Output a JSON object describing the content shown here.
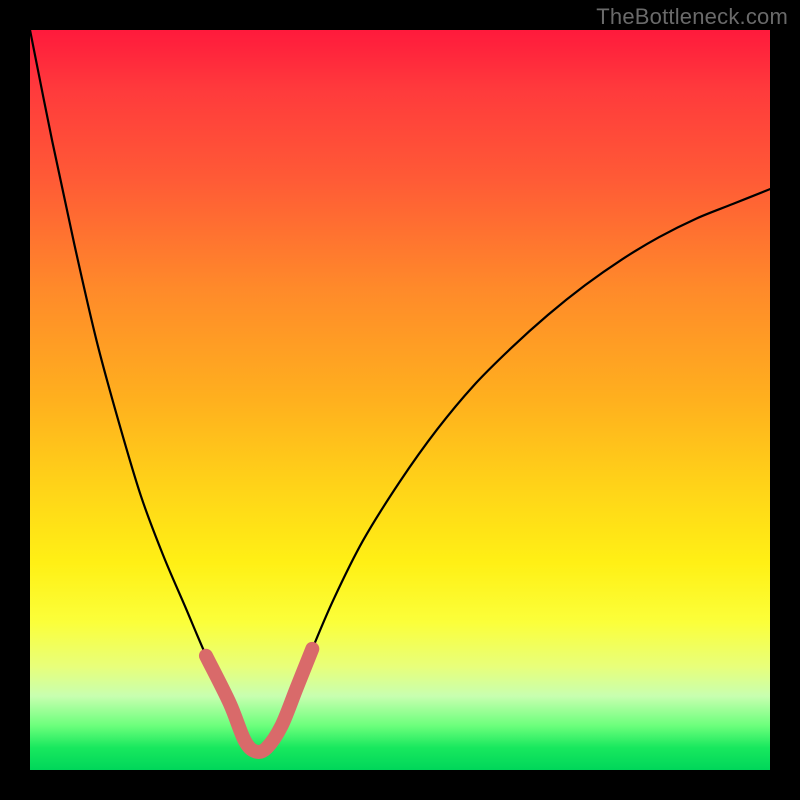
{
  "watermark": "TheBottleneck.com",
  "chart_data": {
    "type": "line",
    "title": "",
    "xlabel": "",
    "ylabel": "",
    "xlim": [
      0,
      100
    ],
    "ylim": [
      0,
      100
    ],
    "x": [
      0,
      3,
      6,
      9,
      12,
      15,
      18,
      21,
      24,
      27,
      29,
      30.5,
      32,
      34,
      36,
      38,
      41,
      45,
      50,
      55,
      60,
      65,
      70,
      75,
      80,
      85,
      90,
      95,
      100
    ],
    "values": [
      100,
      85,
      71,
      58,
      47,
      37,
      29,
      22,
      15,
      9,
      4,
      2.5,
      3,
      6,
      11,
      16,
      23,
      31,
      39,
      46,
      52,
      57,
      61.5,
      65.5,
      69,
      72,
      74.5,
      76.5,
      78.5
    ],
    "highlight_band_x": [
      24,
      38
    ],
    "gradient_stops": [
      {
        "pos": 0,
        "color": "#ff1a3c"
      },
      {
        "pos": 50,
        "color": "#ffd418"
      },
      {
        "pos": 80,
        "color": "#fbff3a"
      },
      {
        "pos": 100,
        "color": "#00d65a"
      }
    ]
  }
}
